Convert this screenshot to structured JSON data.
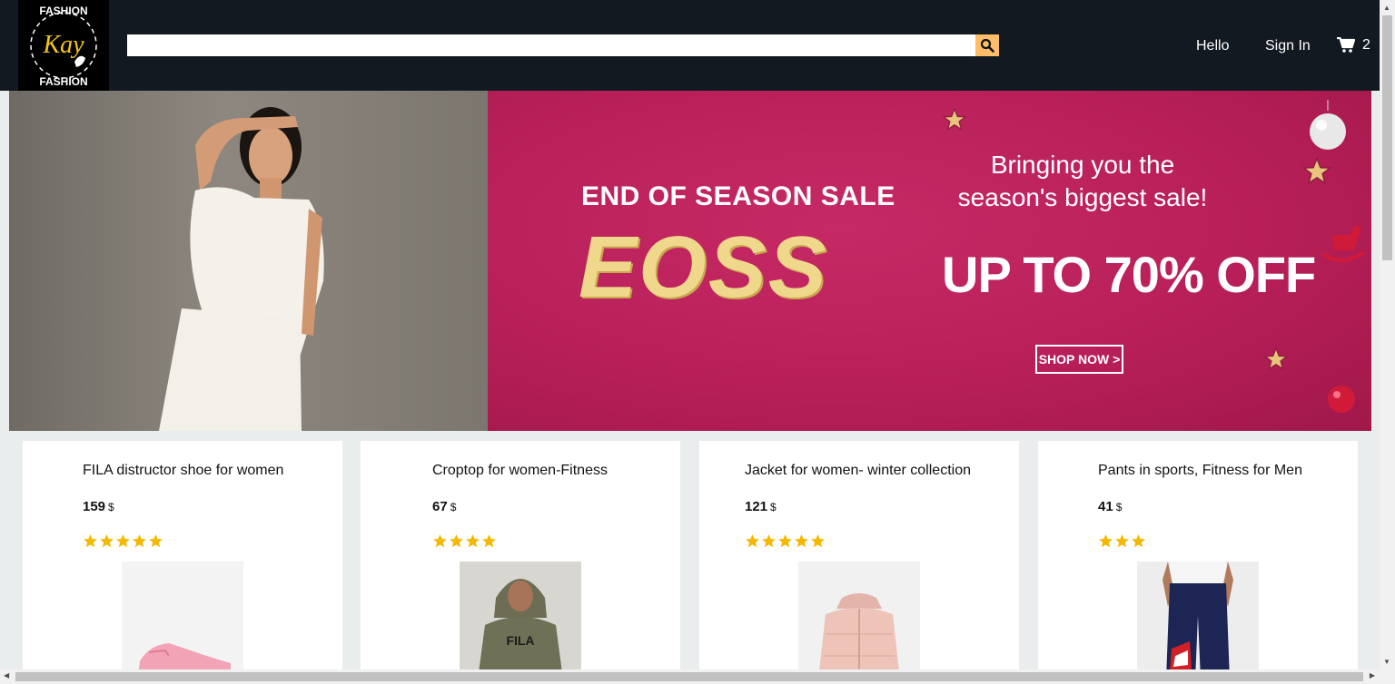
{
  "header": {
    "logo": {
      "text": "Kay",
      "ring_text": "FASHION · FASHION · FASHION ·"
    },
    "search": {
      "placeholder": "",
      "value": ""
    },
    "greeting": "Hello",
    "sign_in": "Sign In",
    "cart_count": "2"
  },
  "banner": {
    "headline": "END OF SEASON SALE",
    "brand": "EOSS",
    "tagline_line1": "Bringing you the",
    "tagline_line2": "season's biggest sale!",
    "offer": "UP TO 70% OFF",
    "cta": "SHOP NOW >"
  },
  "products": [
    {
      "title": "FILA distructor shoe for women",
      "price": "159",
      "currency": "$",
      "rating": 5
    },
    {
      "title": "Croptop for women-Fitness",
      "price": "67",
      "currency": "$",
      "rating": 4
    },
    {
      "title": "Jacket for women- winter collection",
      "price": "121",
      "currency": "$",
      "rating": 5
    },
    {
      "title": "Pants in sports, Fitness for Men",
      "price": "41",
      "currency": "$",
      "rating": 3
    }
  ],
  "colors": {
    "header_bg": "#131921",
    "search_button": "#febd69",
    "star": "#f5b800",
    "banner_pink": "#c1235d",
    "page_bg": "#eaeded"
  }
}
